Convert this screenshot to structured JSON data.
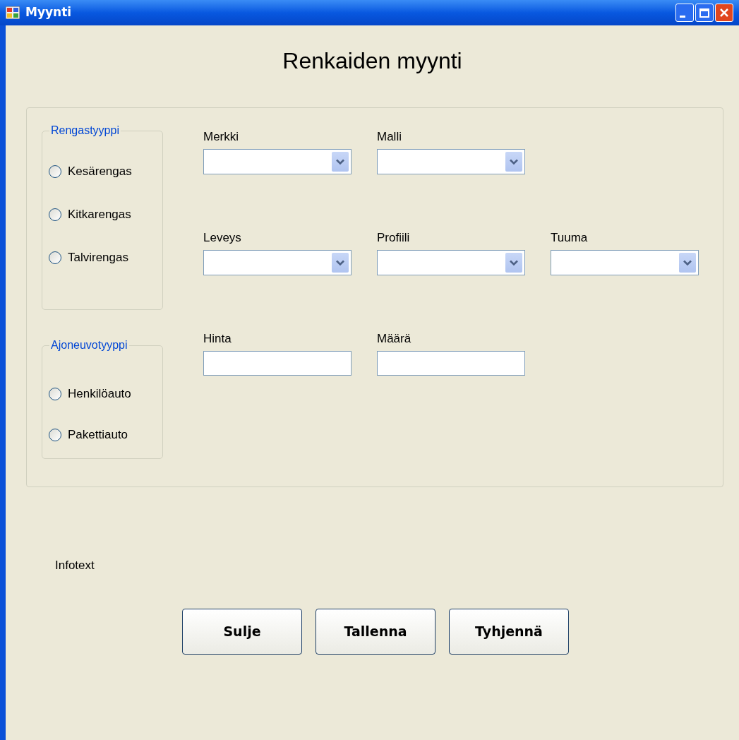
{
  "window": {
    "title": "Myynti"
  },
  "heading": "Renkaiden myynti",
  "groups": [
    {
      "title": "Rengastyyppi",
      "options": [
        {
          "label": "Kesärengas",
          "selected": false
        },
        {
          "label": "Kitkarengas",
          "selected": false
        },
        {
          "label": "Talvirengas",
          "selected": false
        }
      ]
    },
    {
      "title": "Ajoneuvotyyppi",
      "options": [
        {
          "label": "Henkilöauto",
          "selected": false
        },
        {
          "label": "Pakettiauto",
          "selected": false
        }
      ]
    }
  ],
  "field_rows": [
    [
      {
        "label": "Merkki",
        "kind": "combo"
      },
      {
        "label": "Malli",
        "kind": "combo"
      }
    ],
    [
      {
        "label": "Leveys",
        "kind": "combo"
      },
      {
        "label": "Profiili",
        "kind": "combo"
      },
      {
        "label": "Tuuma",
        "kind": "combo"
      }
    ],
    [
      {
        "label": "Hinta",
        "kind": "text"
      },
      {
        "label": "Määrä",
        "kind": "text"
      }
    ]
  ],
  "info": "Infotext",
  "buttons": [
    "Sulje",
    "Tallenna",
    "Tyhjennä"
  ]
}
